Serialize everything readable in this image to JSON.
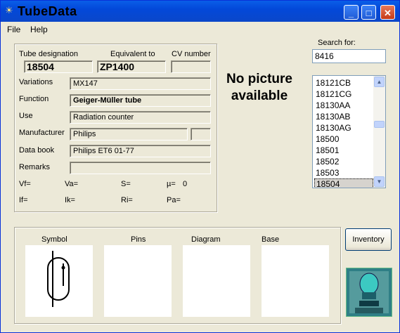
{
  "window": {
    "title": "TubeData"
  },
  "menu": {
    "file": "File",
    "help": "Help"
  },
  "labels": {
    "tube_designation": "Tube designation",
    "equivalent_to": "Equivalent to",
    "cv_number": "CV number",
    "variations": "Variations",
    "function": "Function",
    "use": "Use",
    "manufacturer": "Manufacturer",
    "data_book": "Data book",
    "remarks": "Remarks",
    "vf": "Vf=",
    "va": "Va=",
    "s": "S=",
    "mu": "µ=",
    "if": "If=",
    "ik": "Ik=",
    "ri": "Ri=",
    "pa": "Pa="
  },
  "values": {
    "tube_designation": "18504",
    "equivalent_to": "ZP1400",
    "cv_number": "",
    "variations": "MX147",
    "function": "Geiger-Müller tube",
    "use": "Radiation counter",
    "manufacturer": "Philips",
    "manufacturer_extra": "",
    "data_book": "Philips ET6  01-77",
    "remarks": "",
    "mu": "0"
  },
  "picture_placeholder": "No picture available",
  "search": {
    "label": "Search for:",
    "value": "8416"
  },
  "tube_list": {
    "items": [
      "18121CB",
      "18121CG",
      "18130AA",
      "18130AB",
      "18130AG",
      "18500",
      "18501",
      "18502",
      "18503",
      "18504"
    ],
    "selected": "18504"
  },
  "bottom": {
    "symbol": "Symbol",
    "pins": "Pins",
    "diagram": "Diagram",
    "base": "Base"
  },
  "buttons": {
    "inventory": "Inventory"
  },
  "colors": {
    "title_bar": "#0a4ed0",
    "window_bg": "#ece9d8",
    "selection": "#d6d3ce"
  }
}
